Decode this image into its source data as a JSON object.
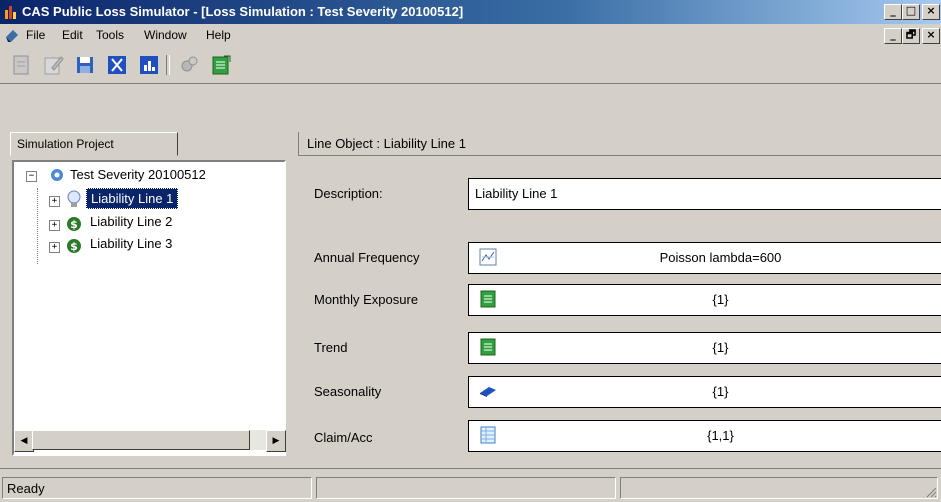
{
  "window": {
    "title": "CAS Public Loss Simulator - [Loss Simulation : Test Severity 20100512]",
    "controls": [
      "_",
      "□",
      "×"
    ],
    "mdi_controls": [
      "_",
      "🗗",
      "×"
    ]
  },
  "menu": {
    "items": [
      "File",
      "Edit",
      "Tools",
      "Window",
      "Help"
    ]
  },
  "toolbar": {
    "icons": [
      "new-icon",
      "edit-icon",
      "save-icon",
      "cut-icon",
      "chart-icon",
      "settings-icon",
      "export-icon"
    ]
  },
  "left_panel": {
    "tab_label": "Simulation Project",
    "tree": {
      "root": "Test Severity 20100512",
      "children": [
        "Liability Line 1",
        "Liability Line 2",
        "Liability Line 3"
      ],
      "selected": "Liability Line 1"
    }
  },
  "right_panel": {
    "header": "Line Object : Liability Line 1",
    "fields": [
      {
        "label": "Description:",
        "value": "Liability Line 1"
      },
      {
        "label": "Annual Frequency",
        "value": "Poisson lambda=600"
      },
      {
        "label": "Monthly Exposure",
        "value": "{1}"
      },
      {
        "label": "Trend",
        "value": "{1}"
      },
      {
        "label": "Seasonality",
        "value": "{1}"
      },
      {
        "label": "Claim/Acc",
        "value": "{1,1}"
      }
    ]
  },
  "status": {
    "text": "Ready"
  },
  "colors": {
    "title_bar_start": "#0a246a",
    "selection": "#0a246a",
    "face": "#d4d0c8"
  }
}
